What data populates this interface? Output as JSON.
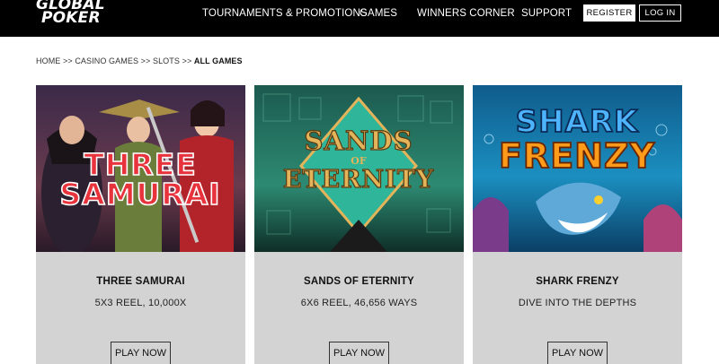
{
  "header": {
    "logo_line1": "GLOBAL",
    "logo_line2": "POKER",
    "nav": [
      "TOURNAMENTS & PROMOTIONS",
      "GAMES",
      "WINNERS CORNER",
      "SUPPORT"
    ],
    "register_label": "REGISTER",
    "login_label": "LOG IN"
  },
  "breadcrumb": {
    "items": [
      "HOME",
      "CASINO GAMES",
      "SLOTS"
    ],
    "separator": ">>",
    "current": "ALL GAMES"
  },
  "games": [
    {
      "art_text_1": "THREE",
      "art_text_2": "SAMURAI",
      "title": "THREE SAMURAI",
      "subtitle": "5X3 REEL, 10,000X",
      "cta": "PLAY NOW"
    },
    {
      "art_text_1": "SANDS",
      "art_text_2": "ETERNITY",
      "art_text_of": "OF",
      "title": "SANDS OF ETERNITY",
      "subtitle": "6X6 REEL, 46,656 WAYS",
      "cta": "PLAY NOW"
    },
    {
      "art_text_1": "SHARK",
      "art_text_2": "FRENZY",
      "title": "SHARK FRENZY",
      "subtitle": "DIVE INTO THE DEPTHS",
      "cta": "PLAY NOW"
    }
  ],
  "colors": {
    "header_bg": "#000000",
    "card_bg": "#d3d3d3",
    "samurai_text": "#e8323c",
    "sands_gold": "#e3b45a",
    "shark_blue": "#4fb4ff",
    "shark_orange": "#ff9a1a"
  }
}
